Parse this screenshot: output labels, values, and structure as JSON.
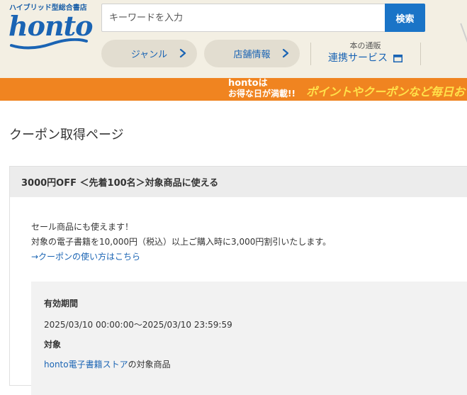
{
  "header": {
    "tagline": "ハイブリッド型総合書店",
    "logo_text": "honto",
    "search": {
      "placeholder": "キーワードを入力",
      "button_label": "検索"
    },
    "nav": {
      "genre_label": "ジャンル",
      "store_label": "店舗情報"
    },
    "linked_service": {
      "sub_label": "本の通販",
      "main_label": "連携サービス"
    }
  },
  "banner": {
    "line1": "hontoは",
    "line2": "お得な日が満載!!",
    "promo": "ポイントやクーポンなど毎日お"
  },
  "page": {
    "title": "クーポン取得ページ"
  },
  "coupon": {
    "header": "3000円OFF ＜先着100名＞対象商品に使える",
    "desc_line1": "セール商品にも使えます！",
    "desc_line2": "対象の電子書籍を10,000円（税込）以上ご購入時に3,000円割引いたします。",
    "usage_link": "→クーポンの使い方はこちら",
    "period_label": "有効期間",
    "period_value": "2025/03/10 00:00:00～2025/03/10 23:59:59",
    "target_label": "対象",
    "target_link": "honto電子書籍ストア",
    "target_suffix": "の対象商品"
  },
  "colors": {
    "brand_blue": "#1a64b4",
    "search_button": "#1a74c7",
    "header_bg": "#f3efe3",
    "banner_orange": "#f08420",
    "banner_yellow": "#ffe14a"
  },
  "icons": {
    "genre_chevron": "chevron-right-icon",
    "store_chevron": "chevron-right-icon",
    "linked_service": "window-icon"
  }
}
